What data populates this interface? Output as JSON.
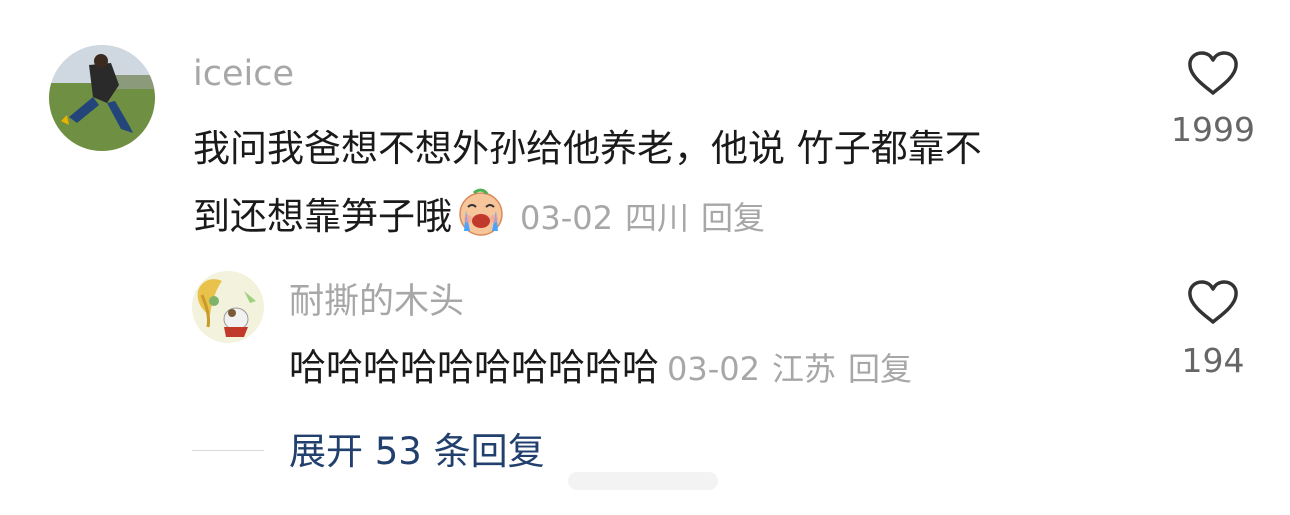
{
  "comment": {
    "username": "iceice",
    "text_line1": "我问我爸想不想外孙给他养老，他说 竹子都靠不",
    "text_line2": "到还想靠笋子哦",
    "emoji": "crying-laughing-emoji",
    "date": "03-02",
    "location": "四川",
    "reply_label": "回复",
    "likes": "1999",
    "like_icon": "heart-outline-icon"
  },
  "reply": {
    "username": "耐撕的木头",
    "text": "哈哈哈哈哈哈哈哈哈哈",
    "date": "03-02",
    "location": "江苏",
    "reply_label": "回复",
    "likes": "194",
    "like_icon": "heart-outline-icon"
  },
  "expand": {
    "label": "展开 53 条回复"
  },
  "colors": {
    "text": "#1a1a1a",
    "meta": "#a7a7a7",
    "link": "#22406e"
  }
}
